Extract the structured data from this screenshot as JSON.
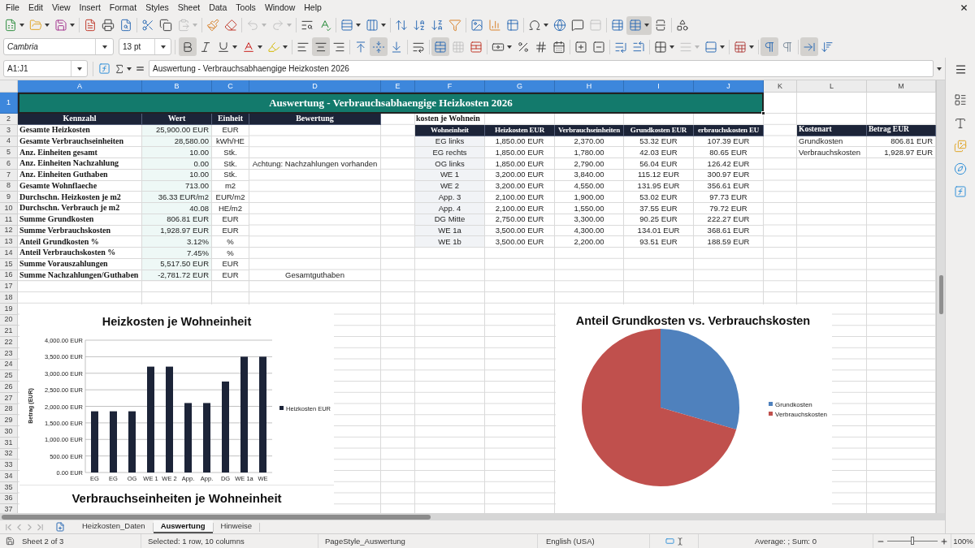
{
  "menu_bar": {
    "items": [
      "File",
      "Edit",
      "View",
      "Insert",
      "Format",
      "Styles",
      "Sheet",
      "Data",
      "Tools",
      "Window",
      "Help"
    ]
  },
  "standard_toolbar": {
    "groups": [
      [
        {
          "kind": "new",
          "dropdown": true,
          "active": false,
          "disabled": false
        },
        {
          "kind": "open",
          "dropdown": true,
          "active": false,
          "disabled": false
        },
        {
          "kind": "save",
          "dropdown": true,
          "active": false,
          "disabled": false
        }
      ],
      [
        {
          "kind": "pdf",
          "dropdown": false,
          "active": false,
          "disabled": false
        },
        {
          "kind": "print",
          "dropdown": false,
          "active": false,
          "disabled": false
        },
        {
          "kind": "preview",
          "dropdown": false,
          "active": false,
          "disabled": false
        }
      ],
      [
        {
          "kind": "cut",
          "dropdown": false,
          "active": false,
          "disabled": false
        },
        {
          "kind": "copy",
          "dropdown": false,
          "active": false,
          "disabled": false
        },
        {
          "kind": "paste",
          "dropdown": true,
          "active": false,
          "disabled": true
        }
      ],
      [
        {
          "kind": "clone",
          "dropdown": false,
          "active": false,
          "disabled": false
        },
        {
          "kind": "clear",
          "dropdown": false,
          "active": false,
          "disabled": false
        }
      ],
      [
        {
          "kind": "undo",
          "dropdown": true,
          "active": false,
          "disabled": true
        },
        {
          "kind": "redo",
          "dropdown": true,
          "active": false,
          "disabled": true
        }
      ],
      [
        {
          "kind": "find",
          "dropdown": false,
          "active": false,
          "disabled": false
        },
        {
          "kind": "spelling",
          "dropdown": false,
          "active": false,
          "disabled": false
        }
      ],
      [
        {
          "kind": "row",
          "dropdown": true,
          "active": false,
          "disabled": false
        },
        {
          "kind": "column",
          "dropdown": true,
          "active": false,
          "disabled": false
        }
      ],
      [
        {
          "kind": "sort",
          "dropdown": false,
          "active": false,
          "disabled": false
        },
        {
          "kind": "ascending",
          "dropdown": false,
          "active": false,
          "disabled": false
        },
        {
          "kind": "descending",
          "dropdown": false,
          "active": false,
          "disabled": false
        },
        {
          "kind": "filter",
          "dropdown": false,
          "active": false,
          "disabled": false
        }
      ],
      [
        {
          "kind": "image",
          "dropdown": false,
          "active": false,
          "disabled": false
        },
        {
          "kind": "chart",
          "dropdown": false,
          "active": false,
          "disabled": false
        },
        {
          "kind": "pivot",
          "dropdown": false,
          "active": false,
          "disabled": false
        }
      ],
      [
        {
          "kind": "symbol",
          "dropdown": true,
          "active": false,
          "disabled": false
        },
        {
          "kind": "hyperlink",
          "dropdown": false,
          "active": false,
          "disabled": false
        },
        {
          "kind": "comment",
          "dropdown": false,
          "active": false,
          "disabled": false
        },
        {
          "kind": "headerfooter",
          "dropdown": false,
          "active": false,
          "disabled": true
        }
      ],
      [
        {
          "kind": "printarea",
          "dropdown": false,
          "active": false,
          "disabled": false
        },
        {
          "kind": "freeze",
          "dropdown": true,
          "active": true,
          "disabled": false
        },
        {
          "kind": "split",
          "dropdown": false,
          "active": false,
          "disabled": false
        }
      ],
      [
        {
          "kind": "draw",
          "dropdown": false,
          "active": false,
          "disabled": false
        }
      ]
    ]
  },
  "formatting_toolbar": {
    "font_name": "Cambria",
    "font_size": "13 pt",
    "groups": [
      [
        {
          "kind": "bold",
          "dropdown": false,
          "active": true,
          "disabled": false
        },
        {
          "kind": "italic",
          "dropdown": false,
          "active": false,
          "disabled": false
        },
        {
          "kind": "underline",
          "dropdown": true,
          "active": false,
          "disabled": false
        },
        {
          "kind": "fontcolor",
          "dropdown": true,
          "active": false,
          "disabled": false
        },
        {
          "kind": "highlight",
          "dropdown": true,
          "active": false,
          "disabled": false
        }
      ],
      [
        {
          "kind": "alignleft",
          "dropdown": false,
          "active": false,
          "disabled": false
        },
        {
          "kind": "aligncenter",
          "dropdown": false,
          "active": true,
          "disabled": false
        },
        {
          "kind": "alignright",
          "dropdown": false,
          "active": false,
          "disabled": false
        }
      ],
      [
        {
          "kind": "aligntop",
          "dropdown": false,
          "active": false,
          "disabled": false
        },
        {
          "kind": "alignmiddle",
          "dropdown": false,
          "active": true,
          "disabled": false
        },
        {
          "kind": "alignbottom",
          "dropdown": false,
          "active": false,
          "disabled": false
        }
      ],
      [
        {
          "kind": "wrap",
          "dropdown": false,
          "active": false,
          "disabled": false
        }
      ],
      [
        {
          "kind": "mergecenter",
          "dropdown": false,
          "active": true,
          "disabled": false
        },
        {
          "kind": "merge",
          "dropdown": false,
          "active": false,
          "disabled": true
        },
        {
          "kind": "unmerge",
          "dropdown": false,
          "active": false,
          "disabled": false
        }
      ],
      [
        {
          "kind": "currency",
          "dropdown": true,
          "active": false,
          "disabled": false
        },
        {
          "kind": "percent",
          "dropdown": false,
          "active": false,
          "disabled": false
        },
        {
          "kind": "number",
          "dropdown": false,
          "active": false,
          "disabled": false
        },
        {
          "kind": "date",
          "dropdown": false,
          "active": false,
          "disabled": false
        }
      ],
      [
        {
          "kind": "adddecimal",
          "dropdown": false,
          "active": false,
          "disabled": false
        },
        {
          "kind": "deletedecimal",
          "dropdown": false,
          "active": false,
          "disabled": false
        }
      ],
      [
        {
          "kind": "indent",
          "dropdown": false,
          "active": false,
          "disabled": false
        },
        {
          "kind": "outdent",
          "dropdown": false,
          "active": false,
          "disabled": false
        }
      ],
      [
        {
          "kind": "borders",
          "dropdown": true,
          "active": false,
          "disabled": false
        },
        {
          "kind": "borderstyle",
          "dropdown": true,
          "active": false,
          "disabled": true
        },
        {
          "kind": "bordercolor",
          "dropdown": true,
          "active": false,
          "disabled": false
        }
      ],
      [
        {
          "kind": "conditional",
          "dropdown": true,
          "active": false,
          "disabled": false
        }
      ],
      [
        {
          "kind": "ltr",
          "dropdown": false,
          "active": true,
          "disabled": false
        },
        {
          "kind": "rtl",
          "dropdown": false,
          "active": false,
          "disabled": false
        }
      ],
      [
        {
          "kind": "horizontal",
          "dropdown": false,
          "active": true,
          "disabled": false
        },
        {
          "kind": "vertical",
          "dropdown": false,
          "active": false,
          "disabled": false
        }
      ]
    ]
  },
  "formula_bar": {
    "name_box": "A1:J1",
    "formula": "Auswertung - Verbrauchsabhaengige Heizkosten 2026"
  },
  "sheet": {
    "columns": [
      {
        "label": "A",
        "selected": true
      },
      {
        "label": "B",
        "selected": true
      },
      {
        "label": "C",
        "selected": true
      },
      {
        "label": "D",
        "selected": true
      },
      {
        "label": "E",
        "selected": true
      },
      {
        "label": "F",
        "selected": true
      },
      {
        "label": "G",
        "selected": true
      },
      {
        "label": "H",
        "selected": true
      },
      {
        "label": "I",
        "selected": true
      },
      {
        "label": "J",
        "selected": true
      },
      {
        "label": "K",
        "selected": false
      },
      {
        "label": "L",
        "selected": false
      },
      {
        "label": "M",
        "selected": false
      }
    ],
    "rows": [
      {
        "label": "1",
        "selected": true
      },
      {
        "label": "2",
        "selected": false
      },
      {
        "label": "3",
        "selected": false
      },
      {
        "label": "4",
        "selected": false
      },
      {
        "label": "5",
        "selected": false
      },
      {
        "label": "6",
        "selected": false
      },
      {
        "label": "7",
        "selected": false
      },
      {
        "label": "8",
        "selected": false
      },
      {
        "label": "9",
        "selected": false
      },
      {
        "label": "10",
        "selected": false
      },
      {
        "label": "11",
        "selected": false
      },
      {
        "label": "12",
        "selected": false
      },
      {
        "label": "13",
        "selected": false
      },
      {
        "label": "14",
        "selected": false
      },
      {
        "label": "15",
        "selected": false
      },
      {
        "label": "16",
        "selected": false
      },
      {
        "label": "17",
        "selected": false
      },
      {
        "label": "18",
        "selected": false
      },
      {
        "label": "19",
        "selected": false
      },
      {
        "label": "20",
        "selected": false
      },
      {
        "label": "21",
        "selected": false
      },
      {
        "label": "22",
        "selected": false
      },
      {
        "label": "23",
        "selected": false
      },
      {
        "label": "24",
        "selected": false
      },
      {
        "label": "25",
        "selected": false
      },
      {
        "label": "26",
        "selected": false
      },
      {
        "label": "27",
        "selected": false
      },
      {
        "label": "28",
        "selected": false
      },
      {
        "label": "29",
        "selected": false
      },
      {
        "label": "30",
        "selected": false
      },
      {
        "label": "31",
        "selected": false
      },
      {
        "label": "32",
        "selected": false
      },
      {
        "label": "33",
        "selected": false
      },
      {
        "label": "34",
        "selected": false
      },
      {
        "label": "35",
        "selected": false
      },
      {
        "label": "36",
        "selected": false
      },
      {
        "label": "37",
        "selected": false
      }
    ],
    "title": {
      "text": "Auswertung - Verbrauchsabhaengige Heizkosten 2026",
      "selected": true
    },
    "summary_table": {
      "columns": [
        "Kennzahl",
        "Wert",
        "Einheit",
        "Bewertung"
      ],
      "rows": [
        [
          "Gesamte Heizkosten",
          "25,900.00 EUR",
          "EUR"
        ],
        [
          "Gesamte Verbrauchseinheiten",
          "28,580.00",
          "kWh/HE"
        ],
        [
          "Anz. Einheiten gesamt",
          "10.00",
          "Stk."
        ],
        [
          "Anz. Einheiten Nachzahlung",
          "0.00",
          "Stk.",
          "Achtung: Nachzahlungen vorhanden"
        ],
        [
          "Anz. Einheiten Guthaben",
          "10.00",
          "Stk."
        ],
        [
          "Gesamte Wohnflaeche",
          "713.00",
          "m2"
        ],
        [
          "Durchschn. Heizkosten je m2",
          "36.33 EUR/m2",
          "EUR/m2"
        ],
        [
          "Durchschn. Verbrauch je m2",
          "40.08",
          "HE/m2"
        ],
        [
          "Summe Grundkosten",
          "806.81 EUR",
          "EUR"
        ],
        [
          "Summe Verbrauchskosten",
          "1,928.97 EUR",
          "EUR"
        ],
        [
          "Anteil Grundkosten %",
          "3.12%",
          "%"
        ],
        [
          "Anteil Verbrauchskosten %",
          "7.45%",
          "%"
        ],
        [
          "Summe Vorauszahlungen",
          "5,517.50 EUR",
          "EUR"
        ],
        [
          "Summe Nachzahlungen/Guthaben",
          "-2,781.72 EUR",
          "EUR",
          "Gesamtguthaben"
        ]
      ]
    },
    "units_table": {
      "caption": "kosten je Wohnein",
      "columns": [
        "Wohneinheit",
        "Heizkosten EUR",
        "Verbrauchseinheiten",
        "Grundkosten EUR",
        "erbrauchskosten EU"
      ],
      "rows": [
        [
          "EG links",
          "1,850.00 EUR",
          "2,370.00",
          "53.32 EUR",
          "107.39 EUR"
        ],
        [
          "EG rechts",
          "1,850.00 EUR",
          "1,780.00",
          "42.03 EUR",
          "80.65 EUR"
        ],
        [
          "OG links",
          "1,850.00 EUR",
          "2,790.00",
          "56.04 EUR",
          "126.42 EUR"
        ],
        [
          "WE 1",
          "3,200.00 EUR",
          "3,840.00",
          "115.12 EUR",
          "300.97 EUR"
        ],
        [
          "WE 2",
          "3,200.00 EUR",
          "4,550.00",
          "131.95 EUR",
          "356.61 EUR"
        ],
        [
          "App. 3",
          "2,100.00 EUR",
          "1,900.00",
          "53.02 EUR",
          "97.73 EUR"
        ],
        [
          "App. 4",
          "2,100.00 EUR",
          "1,550.00",
          "37.55 EUR",
          "79.72 EUR"
        ],
        [
          "DG Mitte",
          "2,750.00 EUR",
          "3,300.00",
          "90.25 EUR",
          "222.27 EUR"
        ],
        [
          "WE 1a",
          "3,500.00 EUR",
          "4,300.00",
          "134.01 EUR",
          "368.61 EUR"
        ],
        [
          "WE 1b",
          "3,500.00 EUR",
          "2,200.00",
          "93.51 EUR",
          "188.59 EUR"
        ]
      ]
    },
    "cost_table": {
      "columns": [
        "Kostenart",
        "Betrag EUR"
      ],
      "rows": [
        [
          "Grundkosten",
          "806.81 EUR"
        ],
        [
          "Verbrauchskosten",
          "1,928.97 EUR"
        ]
      ]
    }
  },
  "bar_chart": {
    "chart_data": {
      "type": "bar",
      "title": "Heizkosten je Wohneinheit",
      "ylabel": "Betrag (EUR)",
      "categories": [
        "EG",
        "EG",
        "OG",
        "WE 1",
        "WE 2",
        "App.",
        "App.",
        "DG",
        "WE 1a",
        "WE"
      ],
      "series": [
        {
          "name": "Heizkosten EUR",
          "color": "#1c2438",
          "values": [
            1850,
            1850,
            1850,
            3200,
            3200,
            2100,
            2100,
            2750,
            3500,
            3500
          ]
        }
      ],
      "ylim": [
        0,
        4000
      ],
      "yticks": [
        {
          "value": 0,
          "label": "0.00 EUR"
        },
        {
          "value": 500,
          "label": "500.00 EUR"
        },
        {
          "value": 1000,
          "label": "1,000.00 EUR"
        },
        {
          "value": 1500,
          "label": "1,500.00 EUR"
        },
        {
          "value": 2000,
          "label": "2,000.00 EUR"
        },
        {
          "value": 2500,
          "label": "2,500.00 EUR"
        },
        {
          "value": 3000,
          "label": "3,000.00 EUR"
        },
        {
          "value": 3500,
          "label": "3,500.00 EUR"
        },
        {
          "value": 4000,
          "label": "4,000.00 EUR"
        }
      ],
      "grid": true,
      "legend": "right"
    }
  },
  "pie_chart": {
    "chart_data": {
      "type": "pie",
      "title": "Anteil Grundkosten vs. Verbrauchskosten",
      "categories": [
        "Grundkosten",
        "Verbrauchskosten"
      ],
      "values": [
        29.49,
        70.51
      ],
      "legend": "right"
    },
    "slices": [
      {
        "color": "#4f81bd"
      },
      {
        "color": "#c0504d"
      }
    ]
  },
  "consumption_chart": {
    "title": "Verbrauchseinheiten je Wohneinheit"
  },
  "sheet_tabs": {
    "tabs": [
      {
        "label": "Heizkosten_Daten",
        "selected": false
      },
      {
        "label": "Auswertung",
        "selected": true
      },
      {
        "label": "Hinweise",
        "selected": false
      }
    ]
  },
  "status_bar": {
    "sheet_position": "Sheet 2 of 3",
    "selection": "Selected: 1 row, 10 columns",
    "page_style": "PageStyle_Auswertung",
    "language": "English (USA)",
    "statistics": "Average: ; Sum: 0",
    "zoom": {
      "level": 0.5,
      "reading": "100%"
    }
  }
}
